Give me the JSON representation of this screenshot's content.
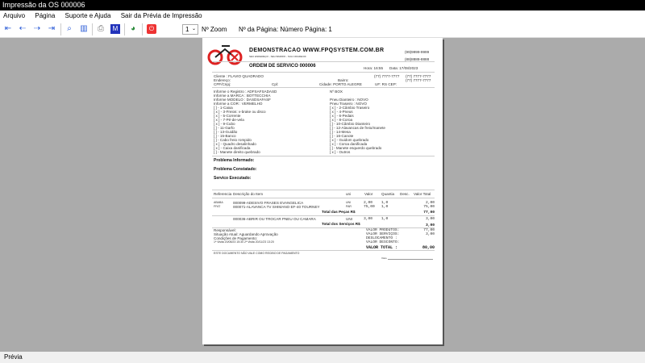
{
  "window": {
    "title": "Impressão da OS 000006"
  },
  "menu": [
    "Arquivo",
    "Página",
    "Suporte e Ajuda",
    "Sair da Prévia de Impressão"
  ],
  "toolbar": {
    "zoom_value": "1",
    "zoom_label": "Nº Zoom",
    "page_label": "Nº da Página: Número Página: 1"
  },
  "status": "Prévia",
  "report": {
    "company": "DEMONSTRACAO WWW.FPQSYSTEM.COM.BR",
    "address": "SEU ENDEREÇO - SEU BAIRRO - SUA CIDADE/UF",
    "phone1": "(99)9999-9999",
    "phone2": "(88)8888-8888",
    "title": "ORDEM DE SERVICO 000006",
    "hora": "Hora: 16:55",
    "data": "Data: 17/08/2023",
    "cliente": "Cliente   : FLAVIO QUADRADO",
    "endereco": "Endereço:",
    "cpf": "CPF/Cnpj:",
    "cpl": "Cpl:",
    "bairro": "Bairro:",
    "cidade": "Cidade: PORTO ALEGRE",
    "uf": "UF: RS  CEP:",
    "tel1": "(77) 7777-7777",
    "tel2": "(77) 7777-7777",
    "tel3": "(77) 7777-7777",
    "info": [
      "Informe o Registro : ADFSAFSADASD",
      "Informe a MARCA   : BOTTECCHIA",
      "Informe MODELO    : DASDSAFASF",
      "Informe a COR       : VERMELHO"
    ],
    "box": "Nº BOX",
    "pneu_d": "Pneu Dianteiro      : NOVO",
    "pneu_t": "Pneu Traseiro        : NOVO",
    "checks_left": [
      "[   ] - 1-Caixa",
      "[ x ] - 3-Freios: v-brake ou disco",
      "[ x ] - 5-Corrente",
      "[ x ] - 7-Pé-de-vela",
      "[ x ] - 9-Cubo",
      "[   ] - 11-Garfo",
      "[   ] - 13-Guidão",
      "[   ] - 15-Banco",
      "[   ] - Cabo freio rompido",
      "[ x ] - Quadro desalinhado",
      "[ x ] - Caixa danificada",
      "[   ] - Manete direito quebrado"
    ],
    "checks_right": [
      "[ x ] - 2-Câmbio Traseiro",
      "[ x ] - 4-Pneus",
      "[ x ] - 6-Pedais",
      "[ x ] - 8-Coroa",
      "[   ] - 10-Câmbio Dianteiro",
      "[   ] - 12-Alavancas de freio/manete",
      "[   ] - 14-Mesa",
      "[   ] - 16-Canote",
      "[ x ] - Guidom quebrado",
      "[ x ] - Coroa danificada",
      "[   ] - Manete esquerdo quebrado",
      "[ x ] - Outros"
    ],
    "prob_inf": "Problema Informado:",
    "prob_const": "Problema Constatado:",
    "serv_exec": "Servico Executado:",
    "cols": [
      "Referencia",
      "Descrição do Item",
      "uni",
      "Valor",
      "Quantia",
      "Desc.",
      "Valor Total"
    ],
    "items": [
      {
        "ref": "ABABA",
        "desc": "000099-ADESIVO FRASES EVANGELICA",
        "uni": "UNI",
        "valor": "2,00",
        "qtd": "1,0",
        "total": "2,00"
      },
      {
        "ref": "FFAT",
        "desc": "000071-ALAVANCA TV SHIMANO EF-40 TOURNEY",
        "uni": "PAR",
        "valor": "75,00",
        "qtd": "1,0",
        "total": "75,00"
      }
    ],
    "total_pecas_label": "Total das Peças R$",
    "total_pecas": "77,00",
    "services": [
      {
        "desc": "000036-ABRIR OU TROCAR PNEU OU CAMARA",
        "uni": "UNI",
        "valor": "3,00",
        "qtd": "1,0",
        "total": "3,00"
      }
    ],
    "total_serv_label": "Total dos Serviços R$",
    "total_serv": "3,00",
    "responsavel": "Responsável:",
    "situacao": "Situação Atual: Aguardando Aprovação",
    "condicoes": "Condições de Pagamento:",
    "datas": "1ª Visita    20/08/23  15:30       2ª Visita    20/11/23  13:20",
    "summary": [
      [
        "VALOR PRODUTOS:",
        "77,00"
      ],
      [
        "VALOR SERVIÇOS:",
        "3,00"
      ],
      [
        "DESLOCAMENTO  :",
        ""
      ],
      [
        "VALOR DESCONTO:",
        ""
      ]
    ],
    "total_label": "VALOR TOTAL   :",
    "total": "80,00",
    "footer": "ESTE DOCUMENTO NÃO VALE COMO RECIBO DE PAGAMENTO",
    "visto": "Visto"
  }
}
